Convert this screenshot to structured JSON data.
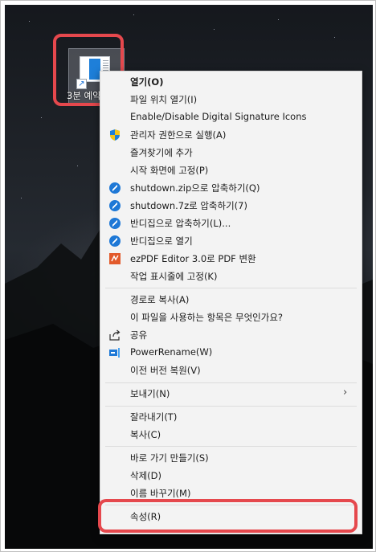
{
  "desktop": {
    "file_label": "3분 예약"
  },
  "menu": {
    "items": [
      {
        "label": "열기(O)",
        "bold": true,
        "icon": ""
      },
      {
        "label": "파일 위치 열기(I)",
        "icon": ""
      },
      {
        "label": "Enable/Disable Digital Signature Icons",
        "icon": ""
      },
      {
        "label": "관리자 권한으로 실행(A)",
        "icon": "shield-icon"
      },
      {
        "label": "즐겨찾기에 추가",
        "icon": ""
      },
      {
        "label": "시작 화면에 고정(P)",
        "icon": ""
      },
      {
        "label": "shutdown.zip으로 압축하기(Q)",
        "icon": "bandizip-icon"
      },
      {
        "label": "shutdown.7z로 압축하기(7)",
        "icon": "bandizip-icon"
      },
      {
        "label": "반디집으로 압축하기(L)...",
        "icon": "bandizip-icon"
      },
      {
        "label": "반디집으로 열기",
        "icon": "bandizip-icon"
      },
      {
        "label": "ezPDF Editor 3.0로 PDF 변환",
        "icon": "ezpdf-icon"
      },
      {
        "label": "작업 표시줄에 고정(K)",
        "icon": ""
      },
      {
        "label": "경로로 복사(A)",
        "icon": ""
      },
      {
        "label": "이 파일을 사용하는 항목은 무엇인가요?",
        "icon": ""
      },
      {
        "label": "공유",
        "icon": "share-icon"
      },
      {
        "label": "PowerRename(W)",
        "icon": "powerrename-icon"
      },
      {
        "label": "이전 버전 복원(V)",
        "icon": ""
      },
      {
        "label": "보내기(N)",
        "icon": "",
        "submenu": true
      },
      {
        "label": "잘라내기(T)",
        "icon": ""
      },
      {
        "label": "복사(C)",
        "icon": ""
      },
      {
        "label": "바로 가기 만들기(S)",
        "icon": ""
      },
      {
        "label": "삭제(D)",
        "icon": ""
      },
      {
        "label": "이름 바꾸기(M)",
        "icon": ""
      },
      {
        "label": "속성(R)",
        "icon": ""
      }
    ]
  },
  "colors": {
    "highlight": "#e5484d",
    "menu_bg": "#f3f3f3",
    "bandizip_blue": "#1e78d6"
  }
}
